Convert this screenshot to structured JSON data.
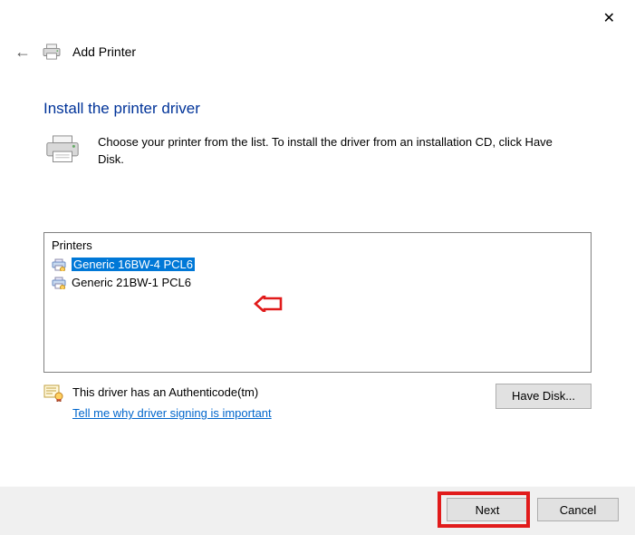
{
  "window": {
    "close": "✕",
    "back": "←",
    "title": "Add Printer"
  },
  "page": {
    "heading": "Install the printer driver",
    "instruction": "Choose your printer from the list. To install the driver from an installation CD, click Have Disk."
  },
  "printers": {
    "header": "Printers",
    "items": [
      {
        "label": "Generic 16BW-4 PCL6",
        "selected": true
      },
      {
        "label": "Generic 21BW-1 PCL6",
        "selected": false
      }
    ]
  },
  "auth": {
    "status": "This driver has an Authenticode(tm)",
    "link": "Tell me why driver signing is important",
    "have_disk": "Have Disk..."
  },
  "footer": {
    "next": "Next",
    "cancel": "Cancel"
  }
}
